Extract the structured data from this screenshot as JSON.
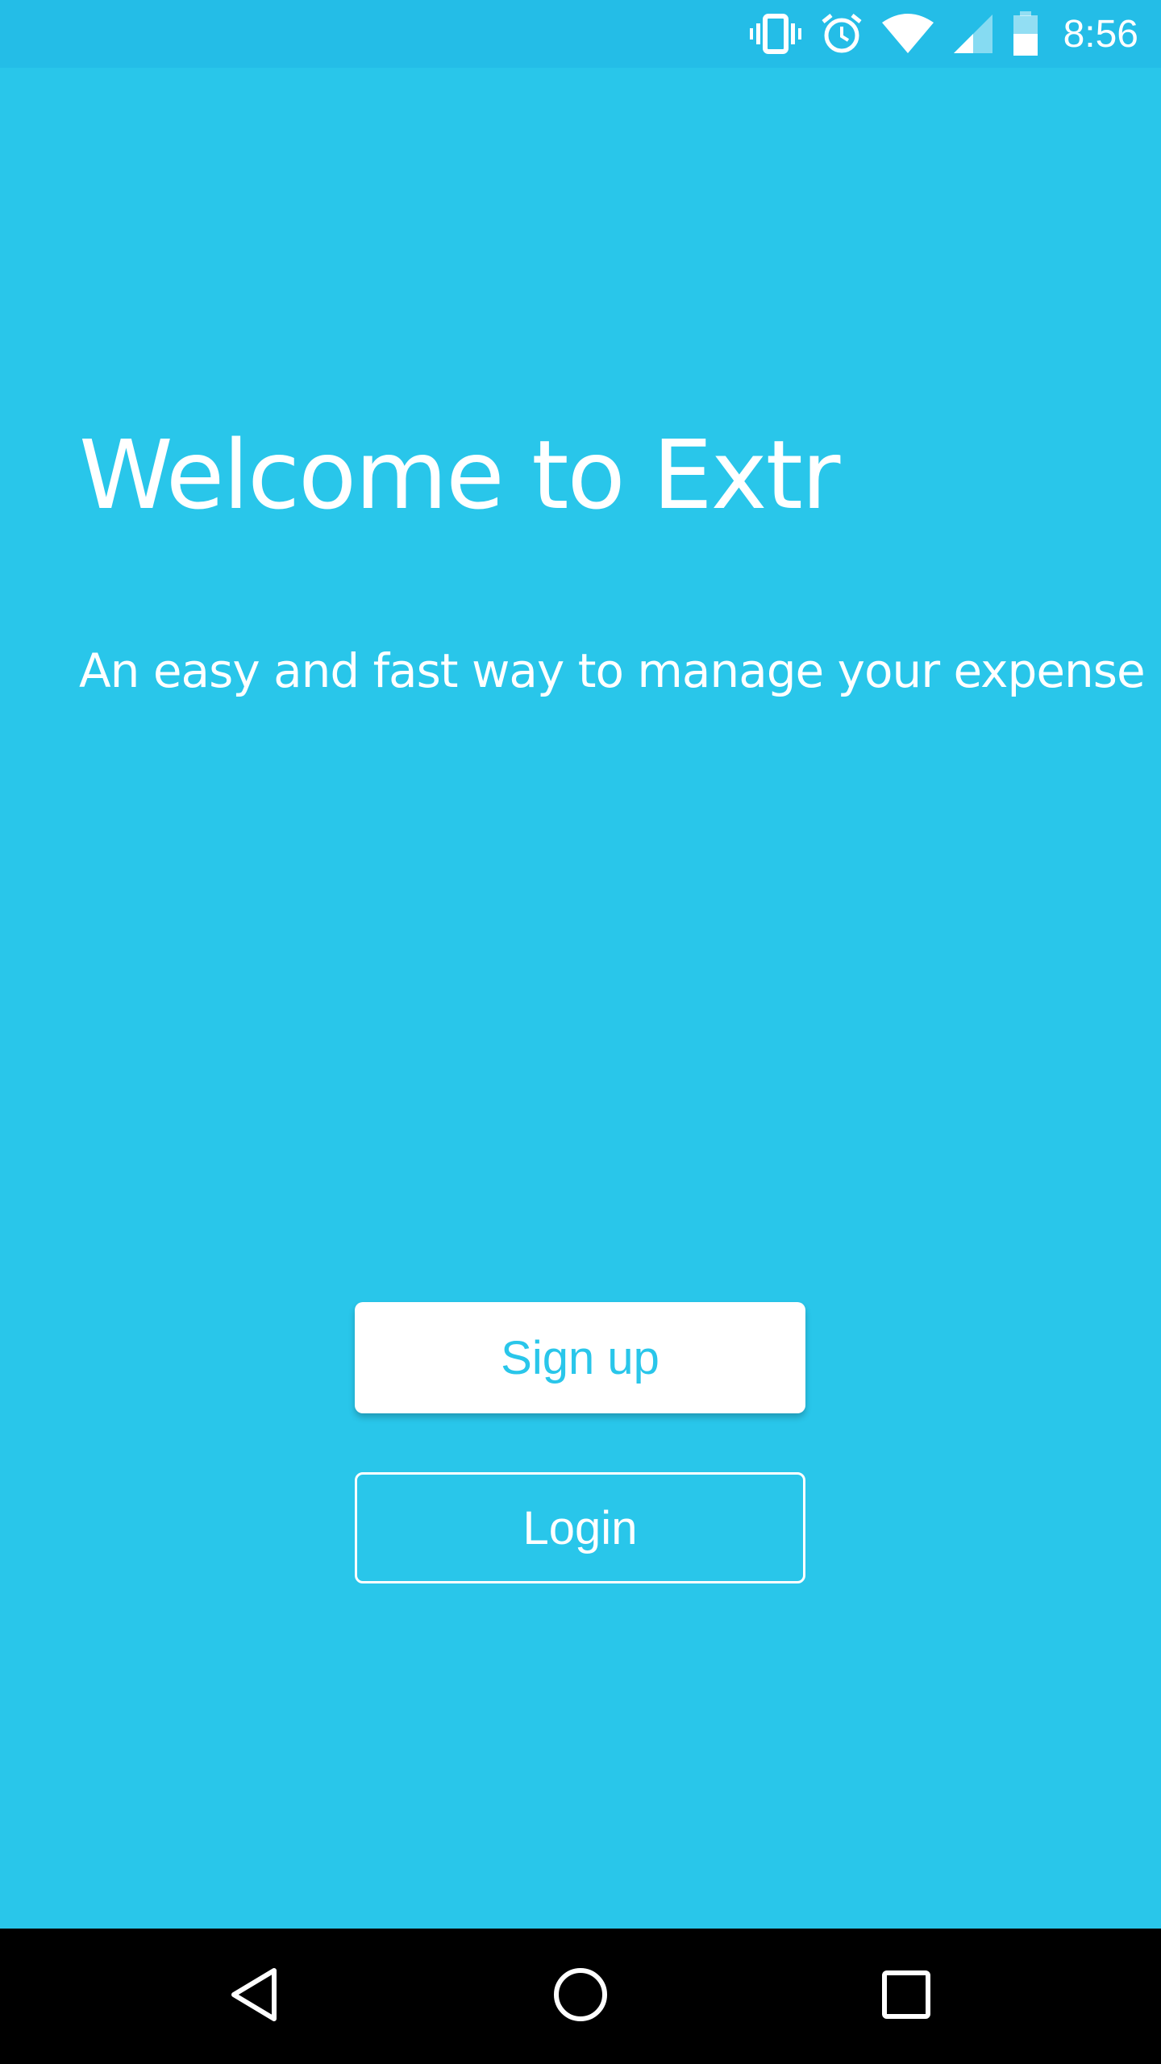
{
  "status_bar": {
    "time": "8:56",
    "icons": [
      "vibrate-icon",
      "alarm-icon",
      "wifi-icon",
      "cell-signal-icon",
      "battery-icon"
    ]
  },
  "welcome": {
    "title": "Welcome to Extr",
    "tagline": "An easy and fast way to manage your expense"
  },
  "actions": {
    "signup_label": "Sign up",
    "login_label": "Login"
  },
  "nav_bar": {
    "icons": [
      "back-icon",
      "home-icon",
      "recents-icon"
    ]
  },
  "colors": {
    "background": "#29C6EA",
    "status_bar": "#24BDE7",
    "text": "#FFFFFF",
    "nav_bar": "#000000"
  }
}
